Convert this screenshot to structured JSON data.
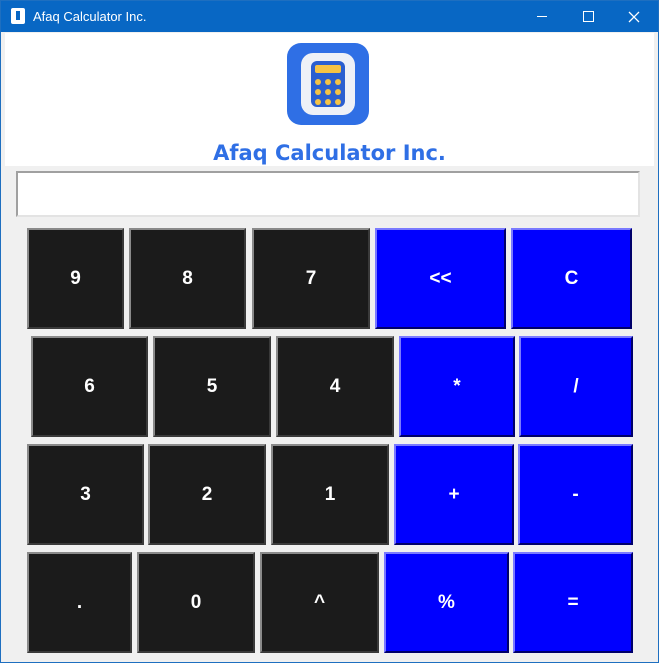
{
  "window": {
    "title": "Afaq Calculator Inc."
  },
  "header": {
    "brand": "Afaq Calculator Inc."
  },
  "display": {
    "value": ""
  },
  "keys": {
    "k9": "9",
    "k8": "8",
    "k7": "7",
    "back": "<<",
    "clear": "C",
    "k6": "6",
    "k5": "5",
    "k4": "4",
    "mul": "*",
    "div": "/",
    "k3": "3",
    "k2": "2",
    "k1": "1",
    "add": "+",
    "sub": "-",
    "dot": ".",
    "k0": "0",
    "pow": "^",
    "mod": "%",
    "eq": "="
  },
  "colors": {
    "title_bar": "#0867c4",
    "number_key": "#1b1b1b",
    "operator_key": "#0000ff",
    "brand": "#2f6fe5"
  }
}
